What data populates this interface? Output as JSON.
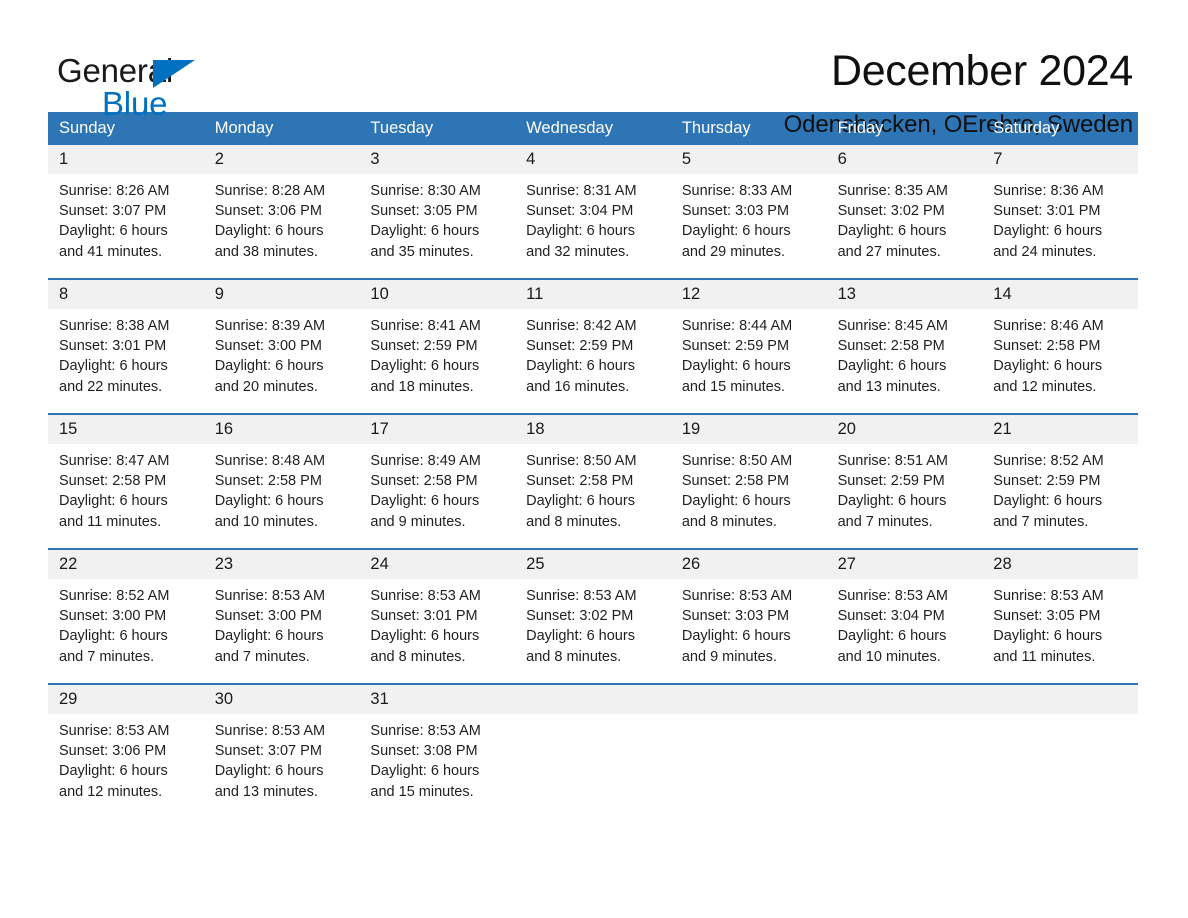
{
  "brand": {
    "name_primary": "General",
    "name_secondary": "Blue",
    "primary_color": "#1a1a1a",
    "secondary_color": "#0070C0"
  },
  "header": {
    "title": "December 2024",
    "subtitle": "Odensbacken, OErebro, Sweden"
  },
  "theme": {
    "header_blue": "#2E75B6",
    "daynum_band": "#F1F1F1",
    "text": "#1f1f1f"
  },
  "calendar": {
    "day_headers": [
      "Sunday",
      "Monday",
      "Tuesday",
      "Wednesday",
      "Thursday",
      "Friday",
      "Saturday"
    ],
    "weeks": [
      [
        {
          "day": "1",
          "info": "Sunrise: 8:26 AM\nSunset: 3:07 PM\nDaylight: 6 hours\nand 41 minutes."
        },
        {
          "day": "2",
          "info": "Sunrise: 8:28 AM\nSunset: 3:06 PM\nDaylight: 6 hours\nand 38 minutes."
        },
        {
          "day": "3",
          "info": "Sunrise: 8:30 AM\nSunset: 3:05 PM\nDaylight: 6 hours\nand 35 minutes."
        },
        {
          "day": "4",
          "info": "Sunrise: 8:31 AM\nSunset: 3:04 PM\nDaylight: 6 hours\nand 32 minutes."
        },
        {
          "day": "5",
          "info": "Sunrise: 8:33 AM\nSunset: 3:03 PM\nDaylight: 6 hours\nand 29 minutes."
        },
        {
          "day": "6",
          "info": "Sunrise: 8:35 AM\nSunset: 3:02 PM\nDaylight: 6 hours\nand 27 minutes."
        },
        {
          "day": "7",
          "info": "Sunrise: 8:36 AM\nSunset: 3:01 PM\nDaylight: 6 hours\nand 24 minutes."
        }
      ],
      [
        {
          "day": "8",
          "info": "Sunrise: 8:38 AM\nSunset: 3:01 PM\nDaylight: 6 hours\nand 22 minutes."
        },
        {
          "day": "9",
          "info": "Sunrise: 8:39 AM\nSunset: 3:00 PM\nDaylight: 6 hours\nand 20 minutes."
        },
        {
          "day": "10",
          "info": "Sunrise: 8:41 AM\nSunset: 2:59 PM\nDaylight: 6 hours\nand 18 minutes."
        },
        {
          "day": "11",
          "info": "Sunrise: 8:42 AM\nSunset: 2:59 PM\nDaylight: 6 hours\nand 16 minutes."
        },
        {
          "day": "12",
          "info": "Sunrise: 8:44 AM\nSunset: 2:59 PM\nDaylight: 6 hours\nand 15 minutes."
        },
        {
          "day": "13",
          "info": "Sunrise: 8:45 AM\nSunset: 2:58 PM\nDaylight: 6 hours\nand 13 minutes."
        },
        {
          "day": "14",
          "info": "Sunrise: 8:46 AM\nSunset: 2:58 PM\nDaylight: 6 hours\nand 12 minutes."
        }
      ],
      [
        {
          "day": "15",
          "info": "Sunrise: 8:47 AM\nSunset: 2:58 PM\nDaylight: 6 hours\nand 11 minutes."
        },
        {
          "day": "16",
          "info": "Sunrise: 8:48 AM\nSunset: 2:58 PM\nDaylight: 6 hours\nand 10 minutes."
        },
        {
          "day": "17",
          "info": "Sunrise: 8:49 AM\nSunset: 2:58 PM\nDaylight: 6 hours\nand 9 minutes."
        },
        {
          "day": "18",
          "info": "Sunrise: 8:50 AM\nSunset: 2:58 PM\nDaylight: 6 hours\nand 8 minutes."
        },
        {
          "day": "19",
          "info": "Sunrise: 8:50 AM\nSunset: 2:58 PM\nDaylight: 6 hours\nand 8 minutes."
        },
        {
          "day": "20",
          "info": "Sunrise: 8:51 AM\nSunset: 2:59 PM\nDaylight: 6 hours\nand 7 minutes."
        },
        {
          "day": "21",
          "info": "Sunrise: 8:52 AM\nSunset: 2:59 PM\nDaylight: 6 hours\nand 7 minutes."
        }
      ],
      [
        {
          "day": "22",
          "info": "Sunrise: 8:52 AM\nSunset: 3:00 PM\nDaylight: 6 hours\nand 7 minutes."
        },
        {
          "day": "23",
          "info": "Sunrise: 8:53 AM\nSunset: 3:00 PM\nDaylight: 6 hours\nand 7 minutes."
        },
        {
          "day": "24",
          "info": "Sunrise: 8:53 AM\nSunset: 3:01 PM\nDaylight: 6 hours\nand 8 minutes."
        },
        {
          "day": "25",
          "info": "Sunrise: 8:53 AM\nSunset: 3:02 PM\nDaylight: 6 hours\nand 8 minutes."
        },
        {
          "day": "26",
          "info": "Sunrise: 8:53 AM\nSunset: 3:03 PM\nDaylight: 6 hours\nand 9 minutes."
        },
        {
          "day": "27",
          "info": "Sunrise: 8:53 AM\nSunset: 3:04 PM\nDaylight: 6 hours\nand 10 minutes."
        },
        {
          "day": "28",
          "info": "Sunrise: 8:53 AM\nSunset: 3:05 PM\nDaylight: 6 hours\nand 11 minutes."
        }
      ],
      [
        {
          "day": "29",
          "info": "Sunrise: 8:53 AM\nSunset: 3:06 PM\nDaylight: 6 hours\nand 12 minutes."
        },
        {
          "day": "30",
          "info": "Sunrise: 8:53 AM\nSunset: 3:07 PM\nDaylight: 6 hours\nand 13 minutes."
        },
        {
          "day": "31",
          "info": "Sunrise: 8:53 AM\nSunset: 3:08 PM\nDaylight: 6 hours\nand 15 minutes."
        },
        {
          "day": "",
          "info": ""
        },
        {
          "day": "",
          "info": ""
        },
        {
          "day": "",
          "info": ""
        },
        {
          "day": "",
          "info": ""
        }
      ]
    ]
  }
}
